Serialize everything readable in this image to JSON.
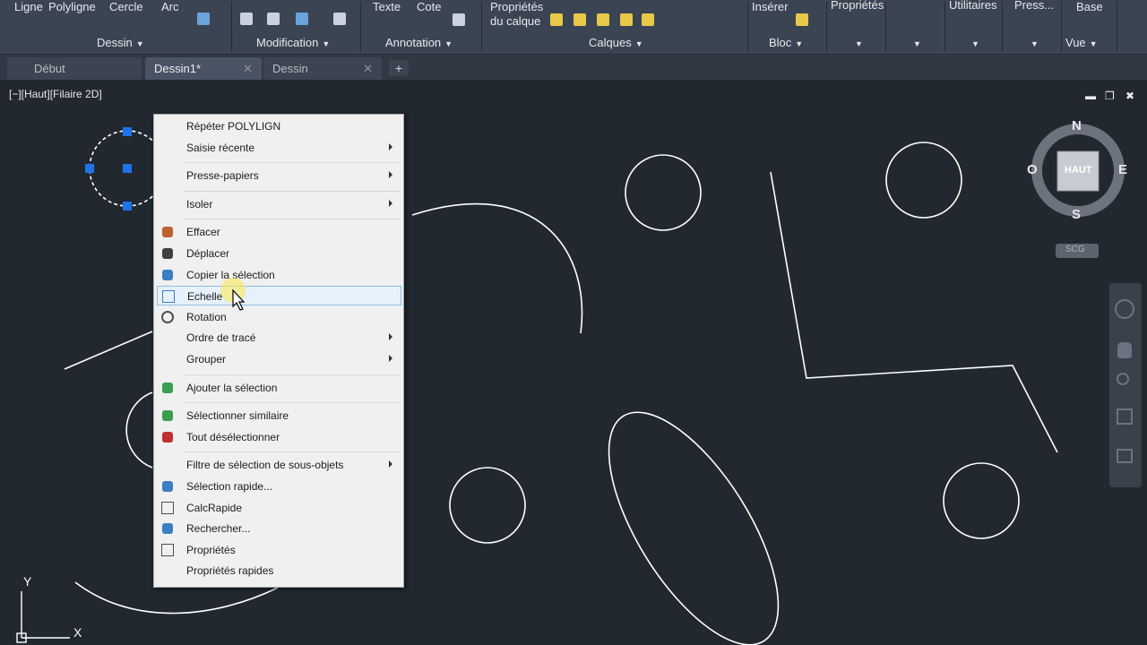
{
  "ribbon": {
    "top_tools": [
      "Ligne",
      "Polyligne",
      "Cercle",
      "Arc"
    ],
    "texte": "Texte",
    "cote": "Cote",
    "proprietes_calque": [
      "Propriétés",
      "du calque"
    ],
    "inserer": "Insérer",
    "right_tools": [
      "Propriétés",
      "Utilitaires",
      "Press...",
      "Base"
    ],
    "panels": [
      "Dessin",
      "Modification",
      "Annotation",
      "Calques",
      "Bloc",
      "Vue"
    ]
  },
  "tabs": [
    {
      "label": "Début"
    },
    {
      "label": "Dessin1*"
    },
    {
      "label": "Dessin"
    }
  ],
  "tab_close": "✕",
  "tab_add": "+",
  "viewport": {
    "label": "[−][Haut][Filaire 2D]",
    "win_min": "▬",
    "win_restore": "❐",
    "win_close": "✖"
  },
  "viewcube": {
    "n": "N",
    "s": "S",
    "e": "E",
    "w": "O",
    "top": "HAUT",
    "ucs": "SCG"
  },
  "ucs_icon": {
    "x": "X",
    "y": "Y"
  },
  "context_menu": [
    {
      "label": "Répéter POLYLIGN",
      "icon": null,
      "submenu": false
    },
    {
      "label": "Saisie récente",
      "icon": null,
      "submenu": true
    },
    {
      "sep": true
    },
    {
      "label": "Presse-papiers",
      "icon": null,
      "submenu": true
    },
    {
      "sep": true
    },
    {
      "label": "Isoler",
      "icon": null,
      "submenu": true
    },
    {
      "sep": true
    },
    {
      "label": "Effacer",
      "icon": "eraser-icon",
      "submenu": false
    },
    {
      "label": "Déplacer",
      "icon": "move-icon",
      "submenu": false
    },
    {
      "label": "Copier la sélection",
      "icon": "copy-selection-icon",
      "submenu": false
    },
    {
      "label": "Echelle",
      "icon": "scale-icon",
      "submenu": false,
      "highlight": true
    },
    {
      "label": "Rotation",
      "icon": "rotate-icon",
      "submenu": false
    },
    {
      "label": "Ordre de tracé",
      "icon": null,
      "submenu": true
    },
    {
      "label": "Grouper",
      "icon": null,
      "submenu": true
    },
    {
      "sep": true
    },
    {
      "label": "Ajouter la sélection",
      "icon": "add-selection-icon",
      "submenu": false
    },
    {
      "sep": true
    },
    {
      "label": "Sélectionner similaire",
      "icon": "select-similar-icon",
      "submenu": false
    },
    {
      "label": "Tout désélectionner",
      "icon": "deselect-all-icon",
      "submenu": false
    },
    {
      "sep": true
    },
    {
      "label": "Filtre de sélection de sous-objets",
      "icon": null,
      "submenu": true
    },
    {
      "label": "Sélection rapide...",
      "icon": "quick-select-icon",
      "submenu": false
    },
    {
      "label": "CalcRapide",
      "icon": "calculator-icon",
      "submenu": false
    },
    {
      "label": "Rechercher...",
      "icon": "find-icon",
      "submenu": false
    },
    {
      "label": "Propriétés",
      "icon": "properties-icon",
      "submenu": false
    },
    {
      "label": "Propriétés rapides",
      "icon": null,
      "submenu": false
    }
  ],
  "colors": {
    "canvas": "#212830",
    "ribbon": "#3b4453",
    "grip": "#1e73e8",
    "highlight": "#e5f1fb"
  }
}
